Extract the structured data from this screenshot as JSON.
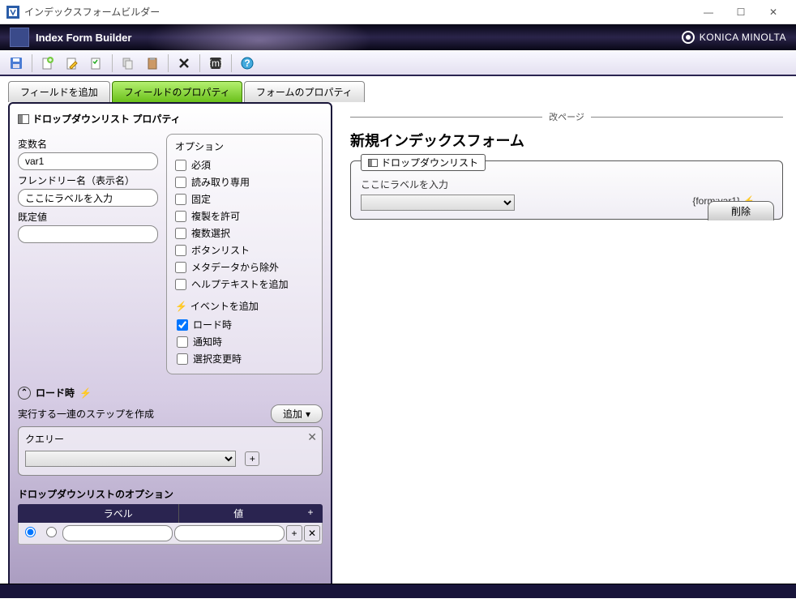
{
  "window": {
    "title": "インデックスフォームビルダー"
  },
  "header": {
    "title": "Index Form Builder",
    "brand": "KONICA MINOLTA"
  },
  "tabs": {
    "add_field": "フィールドを追加",
    "field_props": "フィールドのプロパティ",
    "form_props": "フォームのプロパティ"
  },
  "panel": {
    "title": "ドロップダウンリスト プロパティ",
    "var_label": "変数名",
    "var_value": "var1",
    "friendly_label": "フレンドリー名（表示名）",
    "friendly_value": "ここにラベルを入力",
    "default_label": "既定値",
    "default_value": ""
  },
  "options": {
    "title": "オプション",
    "required": "必須",
    "readonly": "読み取り専用",
    "fixed": "固定",
    "duplicate": "複製を許可",
    "multiselect": "複数選択",
    "buttonlist": "ボタンリスト",
    "exclude_meta": "メタデータから除外",
    "helptext": "ヘルプテキストを追加",
    "events_title": "イベントを追加",
    "on_load": "ロード時",
    "on_notify": "通知時",
    "on_change": "選択変更時"
  },
  "load_section": {
    "title": "ロード時",
    "steps_label": "実行する一連のステップを作成",
    "add_btn": "追加",
    "query_label": "クエリー"
  },
  "grid": {
    "title": "ドロップダウンリストのオプション",
    "col_label": "ラベル",
    "col_value": "値"
  },
  "preview": {
    "page_break": "改ページ",
    "form_title": "新規インデックスフォーム",
    "legend": "ドロップダウンリスト",
    "placeholder_label": "ここにラベルを入力",
    "var_ref": "{form:var1}",
    "delete": "削除"
  }
}
